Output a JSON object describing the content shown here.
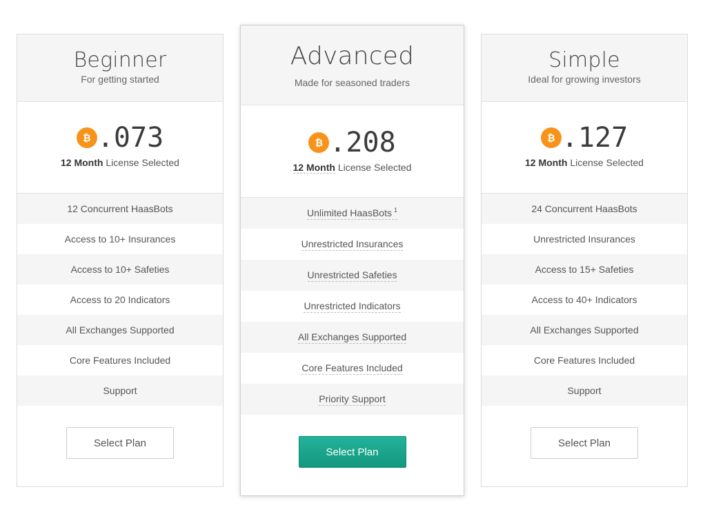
{
  "plans": [
    {
      "title": "Beginner",
      "subtitle": "For getting started",
      "currency_symbol": "₿",
      "amount": ".073",
      "license_duration": "12 Month",
      "license_suffix": " License Selected",
      "features": [
        {
          "text": "12 Concurrent HaasBots"
        },
        {
          "text": "Access to 10+ Insurances"
        },
        {
          "text": "Access to 10+ Safeties"
        },
        {
          "text": "Access to 20 Indicators"
        },
        {
          "text": "All Exchanges Supported"
        },
        {
          "text": "Core Features Included"
        },
        {
          "text": "Support"
        }
      ],
      "button_label": "Select Plan"
    },
    {
      "title": "Advanced",
      "subtitle": "Made for seasoned traders",
      "currency_symbol": "₿",
      "amount": ".208",
      "license_duration": "12 Month",
      "license_suffix": " License Selected",
      "features": [
        {
          "text": "Unlimited HaasBots",
          "sup": "1"
        },
        {
          "text": "Unrestricted Insurances"
        },
        {
          "text": "Unrestricted Safeties"
        },
        {
          "text": "Unrestricted Indicators"
        },
        {
          "text": "All Exchanges Supported"
        },
        {
          "text": "Core Features Included"
        },
        {
          "text": "Priority Support"
        }
      ],
      "button_label": "Select Plan"
    },
    {
      "title": "Simple",
      "subtitle": "Ideal for growing investors",
      "currency_symbol": "₿",
      "amount": ".127",
      "license_duration": "12 Month",
      "license_suffix": " License Selected",
      "features": [
        {
          "text": "24 Concurrent HaasBots"
        },
        {
          "text": "Unrestricted Insurances"
        },
        {
          "text": "Access to 15+ Safeties"
        },
        {
          "text": "Access to 40+ Indicators"
        },
        {
          "text": "All Exchanges Supported"
        },
        {
          "text": "Core Features Included"
        },
        {
          "text": "Support"
        }
      ],
      "button_label": "Select Plan"
    }
  ],
  "colors": {
    "accent": "#1aa68c",
    "bitcoin": "#f7931a",
    "header_bg": "#f5f5f5"
  }
}
